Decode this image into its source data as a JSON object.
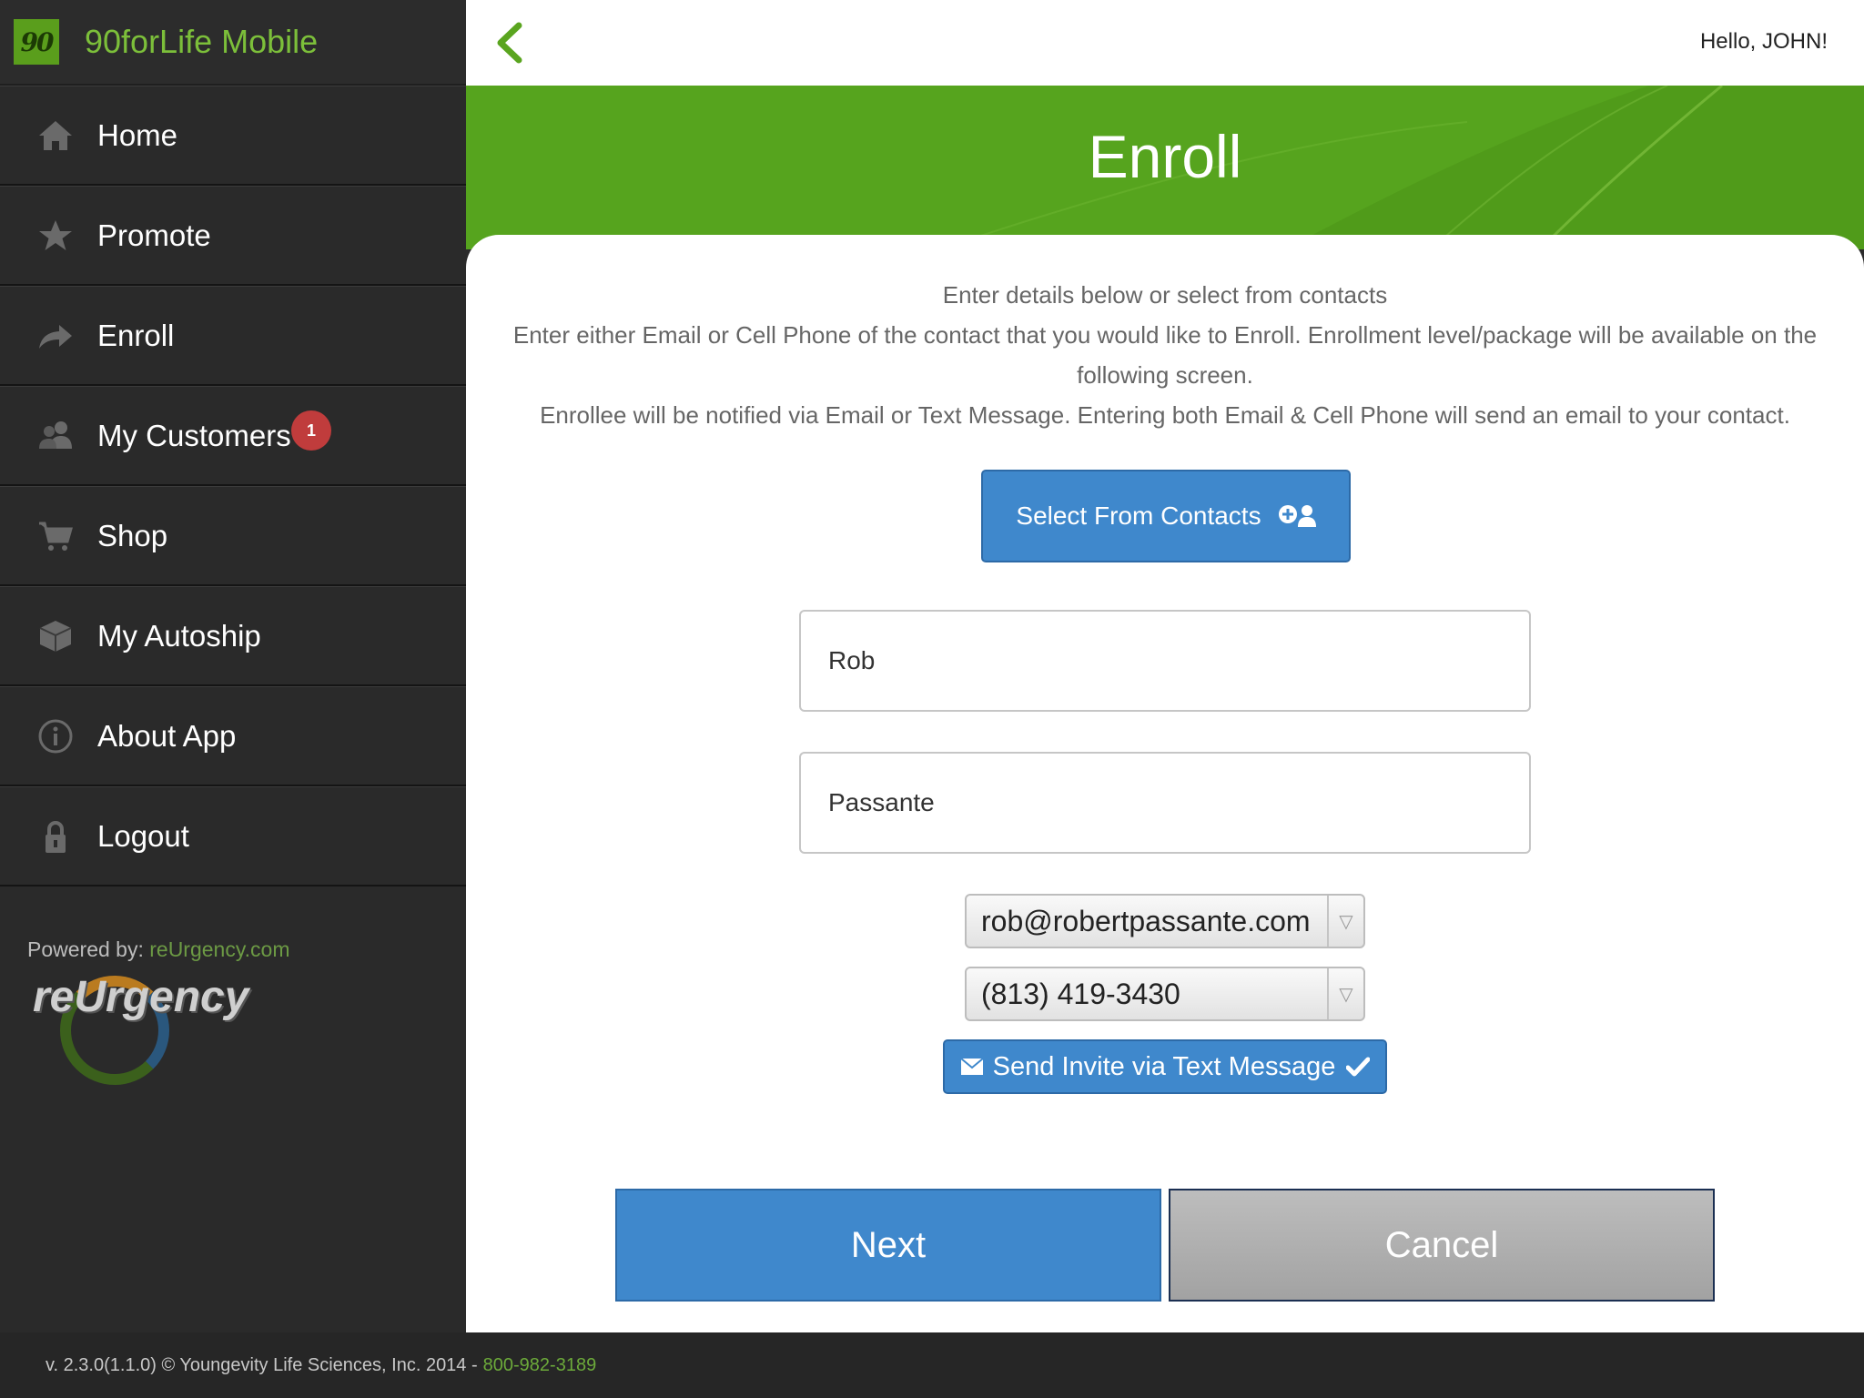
{
  "app": {
    "logo_text": "90",
    "title": "90forLife Mobile"
  },
  "topbar": {
    "greeting": "Hello, JOHN!"
  },
  "sidebar": {
    "items": [
      {
        "label": "Home",
        "icon": "home-icon"
      },
      {
        "label": "Promote",
        "icon": "star-icon"
      },
      {
        "label": "Enroll",
        "icon": "share-arrow-icon"
      },
      {
        "label": "My Customers",
        "icon": "users-icon",
        "badge": "1"
      },
      {
        "label": "Shop",
        "icon": "cart-icon"
      },
      {
        "label": "My Autoship",
        "icon": "box-icon"
      },
      {
        "label": "About App",
        "icon": "info-icon"
      },
      {
        "label": "Logout",
        "icon": "lock-icon"
      }
    ],
    "powered_by_label": "Powered by:",
    "powered_by_link": "reUrgency.com",
    "partner_logo_text": "reUrgency"
  },
  "page": {
    "title": "Enroll",
    "instructions": [
      "Enter details below or select from contacts",
      "Enter either Email or Cell Phone of the contact that you would like to Enroll. Enrollment level/package will be available on the following screen.",
      "Enrollee will be notified via Email or Text Message. Entering both Email & Cell Phone will send an email to your contact."
    ],
    "select_contacts_label": "Select From Contacts",
    "first_name_value": "Rob",
    "last_name_value": "Passante",
    "email_selected": "rob@robertpassante.com",
    "phone_selected": "(813) 419-3430",
    "invite_label": "Send Invite via Text Message",
    "next_label": "Next",
    "cancel_label": "Cancel"
  },
  "footer": {
    "version_text": "v. 2.3.0(1.1.0) © Youngevity Life Sciences, Inc. 2014 -",
    "phone": "800-982-3189"
  },
  "colors": {
    "brand_green": "#56a41e",
    "primary_blue": "#3f88cc",
    "badge_red": "#c03c3c",
    "sidebar_bg": "#2a2a2a"
  }
}
